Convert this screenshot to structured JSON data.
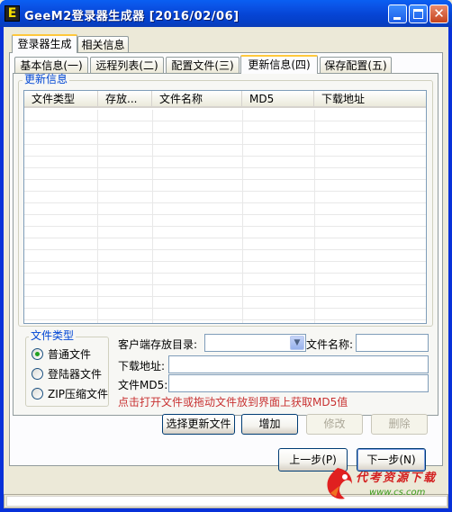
{
  "window": {
    "title": "GeeM2登录器生成器 [2016/02/06]",
    "icon_letter": "E"
  },
  "top_tabs": [
    {
      "label": "登录器生成",
      "active": true
    },
    {
      "label": "相关信息",
      "active": false
    }
  ],
  "sub_tabs": [
    {
      "label": "基本信息(一)",
      "active": false
    },
    {
      "label": "远程列表(二)",
      "active": false
    },
    {
      "label": "配置文件(三)",
      "active": false
    },
    {
      "label": "更新信息(四)",
      "active": true
    },
    {
      "label": "保存配置(五)",
      "active": false
    }
  ],
  "update_group": {
    "caption": "更新信息",
    "columns": [
      "文件类型",
      "存放...",
      "文件名称",
      "MD5",
      "下载地址"
    ],
    "rows": []
  },
  "file_type_group": {
    "caption": "文件类型",
    "options": [
      {
        "label": "普通文件",
        "checked": true
      },
      {
        "label": "登陆器文件",
        "checked": false
      },
      {
        "label": "ZIP压缩文件",
        "checked": false
      }
    ]
  },
  "form": {
    "client_dir_label": "客户端存放目录:",
    "client_dir_value": "",
    "file_name_label": "文件名称:",
    "file_name_value": "",
    "download_label": "下载地址:",
    "download_value": "",
    "md5_label": "文件MD5:",
    "md5_value": "",
    "hint": "点击打开文件或拖动文件放到界面上获取MD5值"
  },
  "actions": {
    "select_file": "选择更新文件",
    "add": "增加",
    "modify": "修改",
    "delete": "删除"
  },
  "nav": {
    "prev": "上一步(P)",
    "next": "下一步(N)"
  },
  "watermark": {
    "text": "代考资源下载",
    "sub": "www.cs.com"
  },
  "colors": {
    "title_bar": "#0a4fe0",
    "accent_blue": "#0046d5",
    "hint_red": "#c83232",
    "active_tab_highlight": "#ffc83c"
  }
}
